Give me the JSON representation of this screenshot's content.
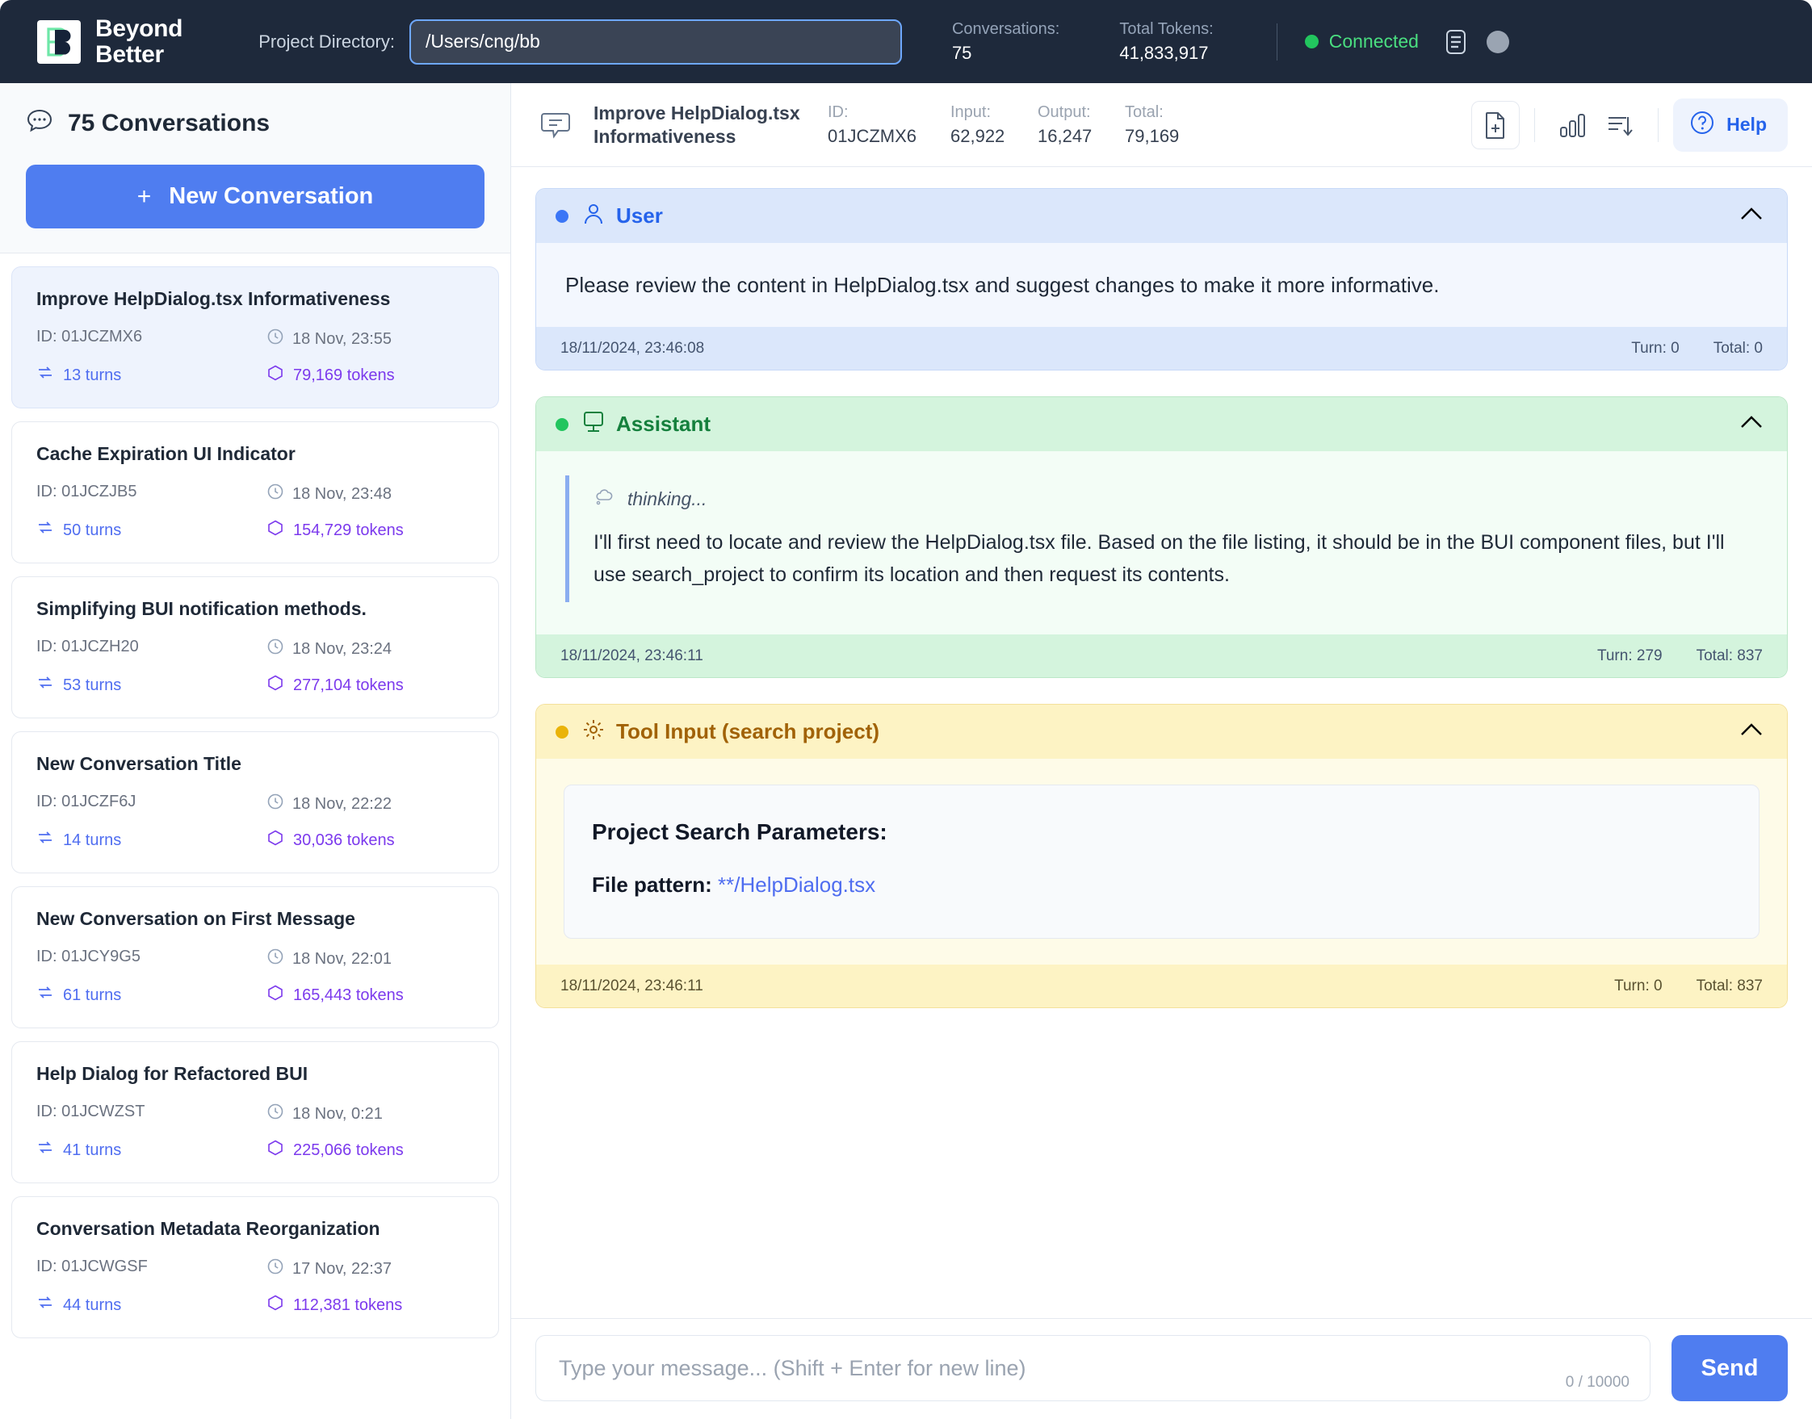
{
  "topbar": {
    "brand_line1": "Beyond",
    "brand_line2": "Better",
    "logo_icon": "beyond-better-logo",
    "project_dir_label": "Project Directory:",
    "project_dir_value": "/Users/cng/bb",
    "project_dir_placeholder": "/path/to/project",
    "conversations_label": "Conversations:",
    "conversations_value": "75",
    "total_tokens_label": "Total Tokens:",
    "total_tokens_value": "41,833,917",
    "connection_status": "Connected",
    "connection_color": "#4ade80",
    "notes_icon": "document-list-icon",
    "avatar_icon": "avatar-circle-icon"
  },
  "sidebar": {
    "title": "75 Conversations",
    "title_icon": "chat-bubble-icon",
    "new_conversation_label": "New Conversation",
    "new_conversation_plus": "+",
    "conversations": [
      {
        "title": "Improve HelpDialog.tsx Informativeness",
        "id": "ID: 01JCZMX6",
        "time": "18 Nov, 23:55",
        "turns": "13 turns",
        "tokens": "79,169 tokens",
        "active": true
      },
      {
        "title": "Cache Expiration UI Indicator",
        "id": "ID: 01JCZJB5",
        "time": "18 Nov, 23:48",
        "turns": "50 turns",
        "tokens": "154,729 tokens",
        "active": false
      },
      {
        "title": "Simplifying BUI notification methods.",
        "id": "ID: 01JCZH20",
        "time": "18 Nov, 23:24",
        "turns": "53 turns",
        "tokens": "277,104 tokens",
        "active": false
      },
      {
        "title": "New Conversation Title",
        "id": "ID: 01JCZF6J",
        "time": "18 Nov, 22:22",
        "turns": "14 turns",
        "tokens": "30,036 tokens",
        "active": false
      },
      {
        "title": "New Conversation on First Message",
        "id": "ID: 01JCY9G5",
        "time": "18 Nov, 22:01",
        "turns": "61 turns",
        "tokens": "165,443 tokens",
        "active": false
      },
      {
        "title": "Help Dialog for Refactored BUI",
        "id": "ID: 01JCWZST",
        "time": "18 Nov, 0:21",
        "turns": "41 turns",
        "tokens": "225,066 tokens",
        "active": false
      },
      {
        "title": "Conversation Metadata Reorganization",
        "id": "ID: 01JCWGSF",
        "time": "17 Nov, 22:37",
        "turns": "44 turns",
        "tokens": "112,381 tokens",
        "active": false
      }
    ]
  },
  "conversation_header": {
    "icon": "conversation-bubble-icon",
    "title": "Improve HelpDialog.tsx Informativeness",
    "stats": [
      {
        "label": "ID:",
        "value": "01JCZMX6"
      },
      {
        "label": "Input:",
        "value": "62,922"
      },
      {
        "label": "Output:",
        "value": "16,247"
      },
      {
        "label": "Total:",
        "value": "79,169"
      }
    ],
    "new_file_icon": "file-plus-icon",
    "metrics_icon": "bar-chart-icon",
    "sort_icon": "sort-descending-icon",
    "help_label": "Help",
    "help_icon": "question-circle-icon"
  },
  "messages": [
    {
      "kind": "user",
      "role": "User",
      "role_icon": "person-icon",
      "collapse_icon": "chevron-up-icon",
      "text": "Please review the content in HelpDialog.tsx and suggest changes to make it more informative.",
      "timestamp": "18/11/2024, 23:46:08",
      "turn": "Turn: 0",
      "total": "Total: 0"
    },
    {
      "kind": "assistant",
      "role": "Assistant",
      "role_icon": "monitor-icon",
      "collapse_icon": "chevron-up-icon",
      "thinking_label": "thinking...",
      "thinking_icon": "thought-cloud-icon",
      "text": "I'll first need to locate and review the HelpDialog.tsx file. Based on the file listing, it should be in the BUI component files, but I'll use search_project to confirm its location and then request its contents.",
      "timestamp": "18/11/2024, 23:46:11",
      "turn": "Turn: 279",
      "total": "Total: 837"
    },
    {
      "kind": "tool",
      "role": "Tool Input (search project)",
      "role_icon": "gear-icon",
      "collapse_icon": "chevron-up-icon",
      "card_heading": "Project Search Parameters:",
      "param_label": "File pattern:",
      "param_value": "**/HelpDialog.tsx",
      "timestamp": "18/11/2024, 23:46:11",
      "turn": "Turn: 0",
      "total": "Total: 837"
    }
  ],
  "composer": {
    "placeholder": "Type your message... (Shift + Enter for new line)",
    "value": "",
    "char_count": "0 / 10000",
    "send_label": "Send"
  }
}
